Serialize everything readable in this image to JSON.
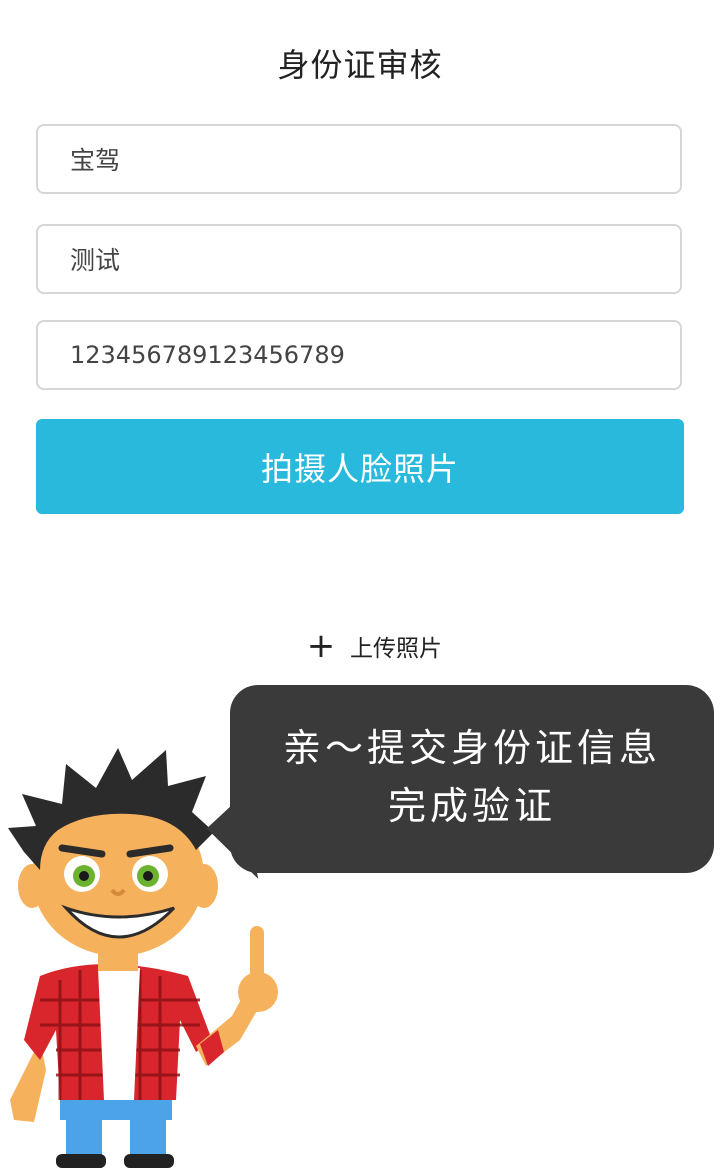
{
  "header": {
    "title": "身份证审核"
  },
  "form": {
    "field1_value": "宝驾",
    "field2_value": "测试",
    "field3_value": "123456789123456789",
    "capture_button": "拍摄人脸照片",
    "upload_icon": "plus-icon",
    "upload_label": "上传照片"
  },
  "bubble": {
    "line1": "亲～提交身份证信息",
    "line2": "完成验证"
  },
  "colors": {
    "accent": "#29b9dc",
    "bubble": "#3a3a3a"
  }
}
